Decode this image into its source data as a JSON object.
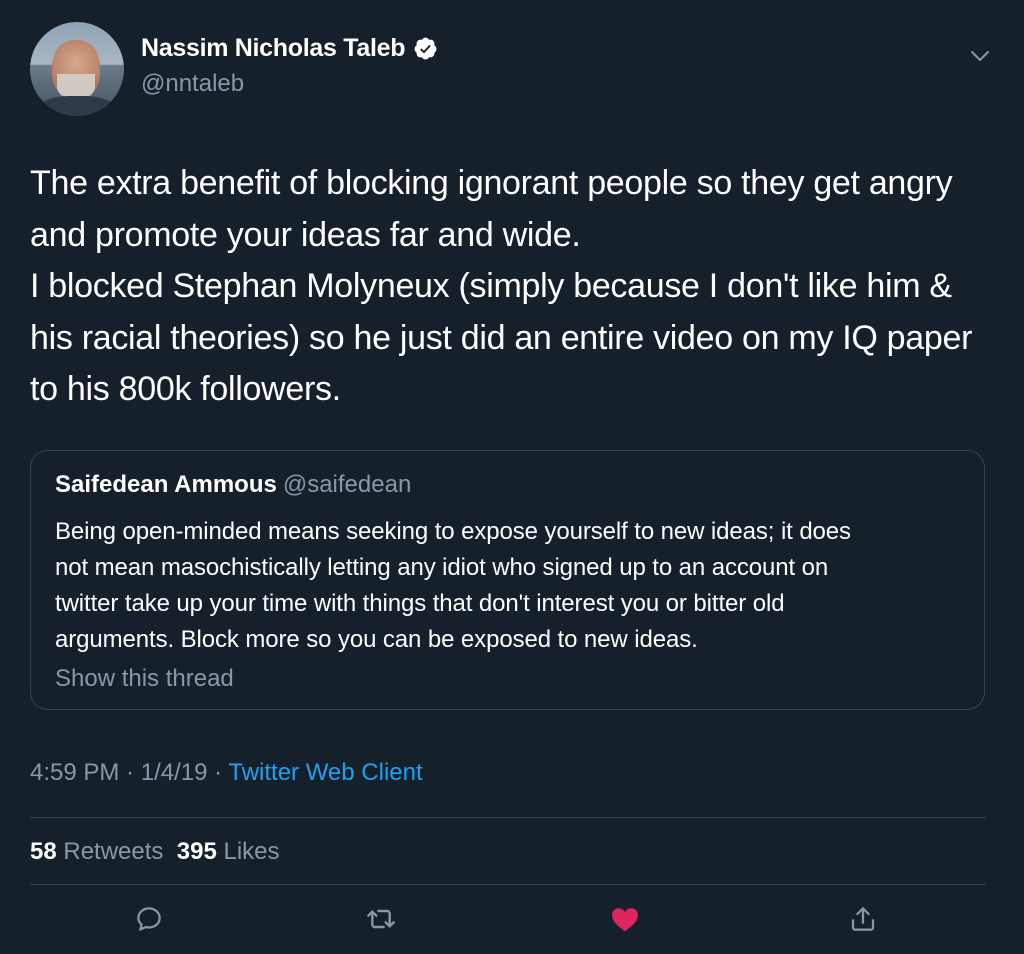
{
  "author": {
    "name": "Nassim Nicholas Taleb",
    "handle": "@nntaleb",
    "verified_icon": "verified-badge-icon"
  },
  "tweet": {
    "lines": [
      "The extra benefit of blocking ignorant people so they get angry",
      "and promote your ideas far and wide.",
      "I blocked Stephan Molyneux (simply because I don't like him &",
      "his racial theories) so he just did an entire video on my IQ paper",
      "to his 800k followers."
    ]
  },
  "quoted_tweet": {
    "name": "Saifedean Ammous",
    "handle": "@saifedean",
    "lines": [
      "Being open-minded means seeking to expose yourself to new ideas; it does",
      "not mean masochistically letting any idiot who signed up to an account on",
      "twitter take up your time with things that don't interest you or bitter old",
      "arguments. Block more so you can be exposed to new ideas."
    ],
    "show_thread": "Show this thread"
  },
  "meta": {
    "time": "4:59 PM",
    "separator": " · ",
    "date": "1/4/19",
    "client": "Twitter Web Client"
  },
  "stats": {
    "retweets_count": "58",
    "retweets_label": " Retweets",
    "likes_count": "395",
    "likes_label": " Likes"
  },
  "colors": {
    "background": "#15202b",
    "secondary_text": "#8899a6",
    "link": "#1da1f2",
    "like": "#e0245e",
    "border": "#38444d"
  },
  "actions": [
    "reply-icon",
    "retweet-icon",
    "like-icon",
    "share-icon"
  ]
}
